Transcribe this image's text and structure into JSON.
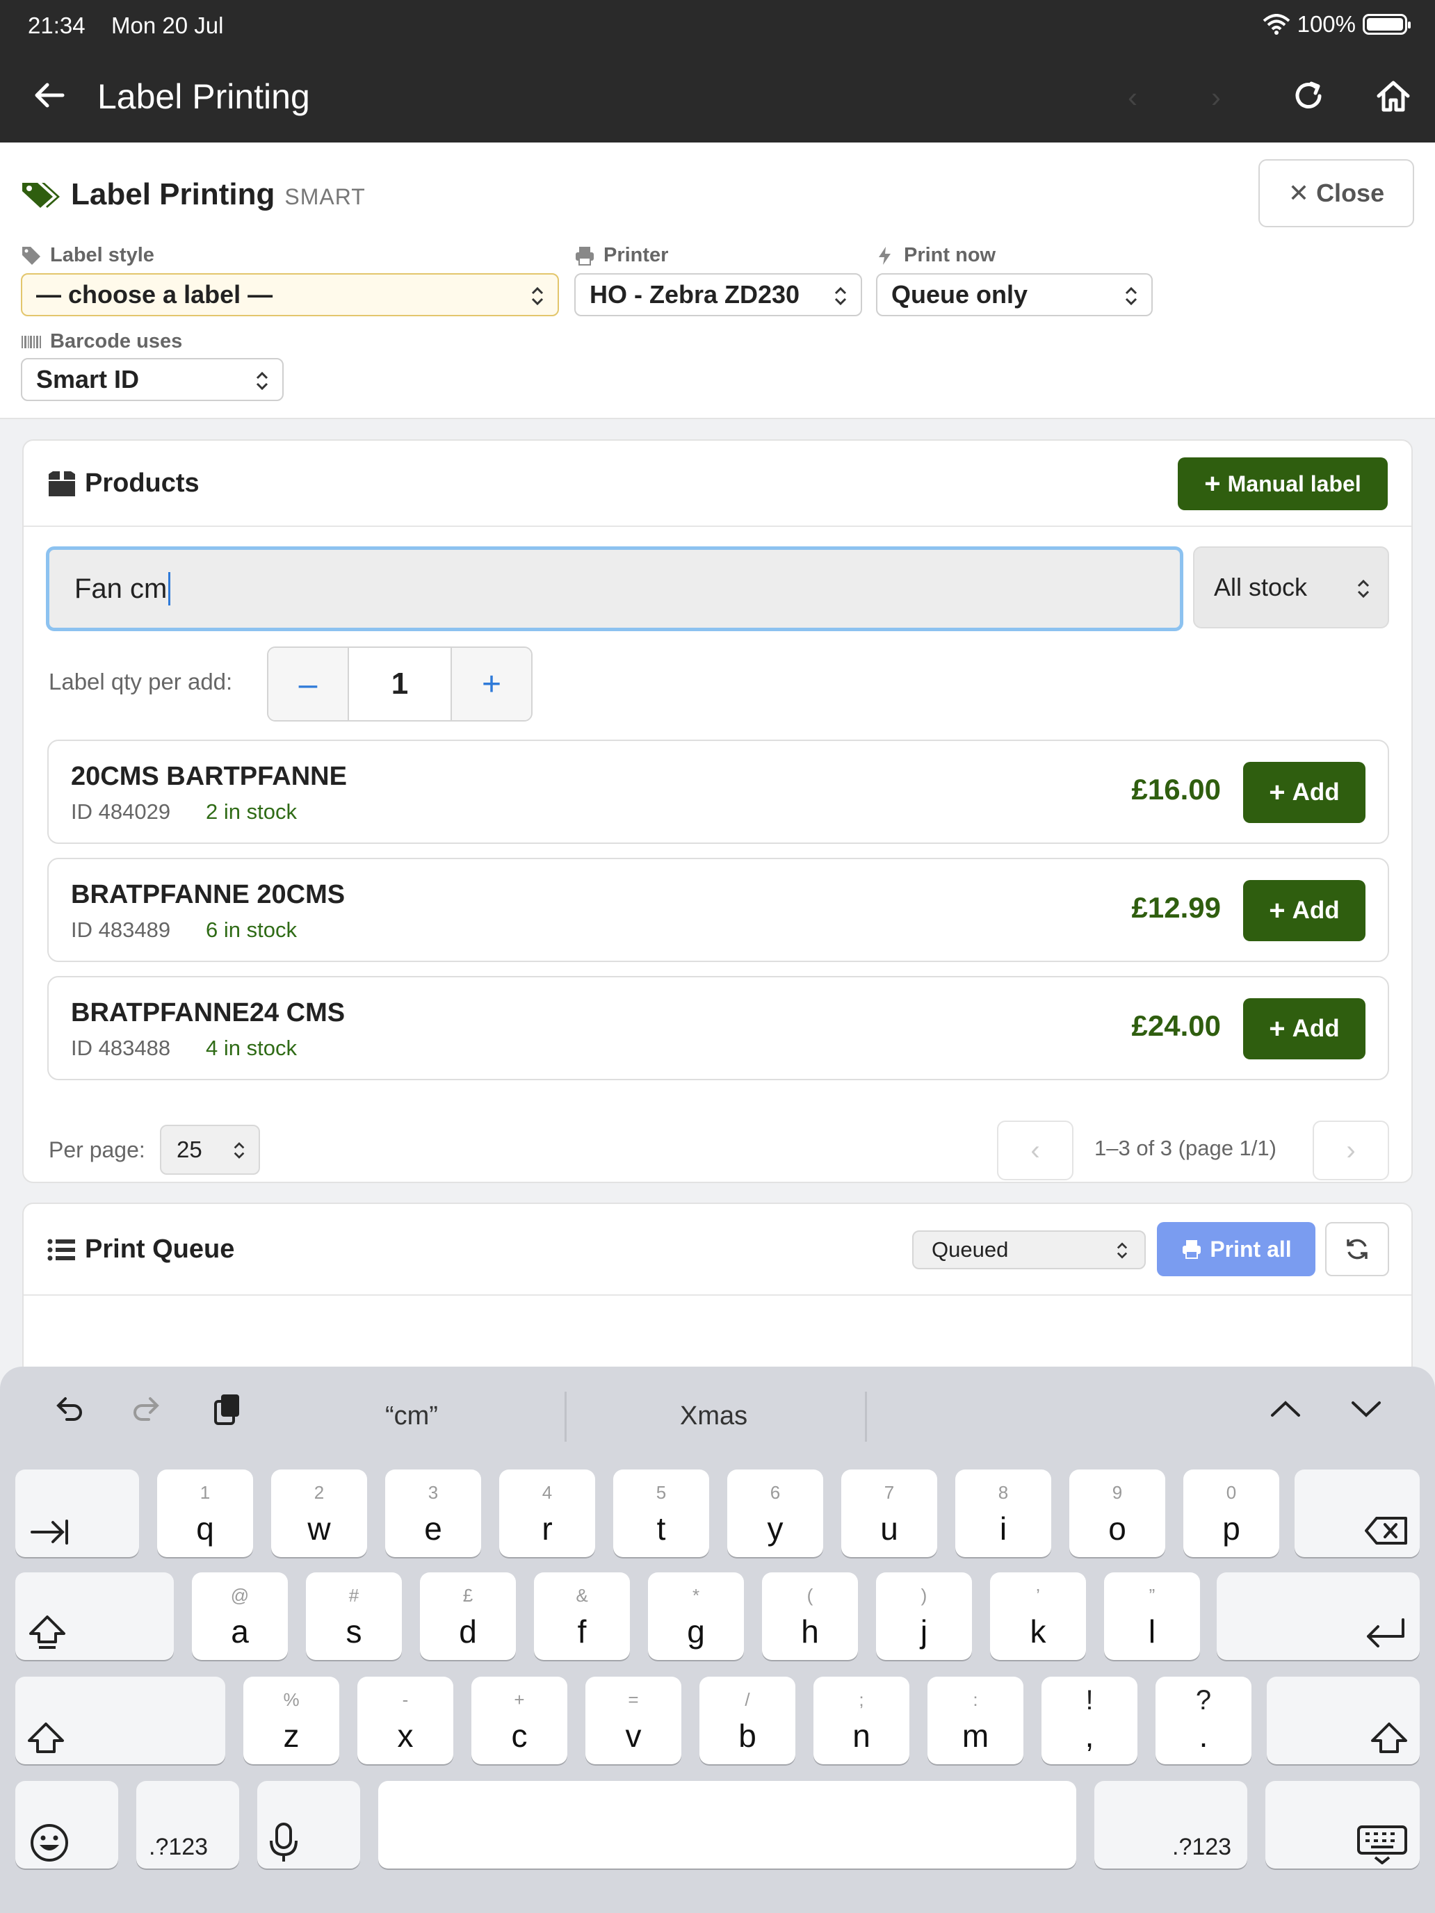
{
  "status": {
    "time": "21:34",
    "date": "Mon 20 Jul",
    "battery": "100%",
    "battery_level": 1.0
  },
  "appbar": {
    "title": "Label Printing"
  },
  "header": {
    "title": "Label Printing",
    "subtitle": "SMART",
    "close_label": "Close",
    "label_style": {
      "label": "Label style",
      "value": "— choose a label —"
    },
    "printer": {
      "label": "Printer",
      "value": "HO - Zebra ZD230"
    },
    "print_now": {
      "label": "Print now",
      "value": "Queue only"
    },
    "barcode": {
      "label": "Barcode uses",
      "value": "Smart ID"
    }
  },
  "products": {
    "title": "Products",
    "manual_label": "Manual label",
    "search_value": "Fan cm",
    "stock_filter": "All stock",
    "qty_label": "Label qty per add:",
    "qty_value": "1",
    "items": [
      {
        "name": "20CMS BARTPFANNE",
        "id": "ID 484029",
        "stock": "2 in stock",
        "price": "£16.00",
        "add": "Add"
      },
      {
        "name": "BRATPFANNE 20CMS",
        "id": "ID 483489",
        "stock": "6 in stock",
        "price": "£12.99",
        "add": "Add"
      },
      {
        "name": "BRATPFANNE24 CMS",
        "id": "ID 483488",
        "stock": "4 in stock",
        "price": "£24.00",
        "add": "Add"
      }
    ],
    "per_page_label": "Per page:",
    "per_page_value": "25",
    "pagination": "1–3 of 3 (page 1/1)"
  },
  "queue": {
    "title": "Print Queue",
    "filter": "Queued",
    "print_all": "Print all"
  },
  "keyboard": {
    "suggestions": [
      "“cm”",
      "Xmas"
    ],
    "row1": [
      {
        "k": "q",
        "s": "1"
      },
      {
        "k": "w",
        "s": "2"
      },
      {
        "k": "e",
        "s": "3"
      },
      {
        "k": "r",
        "s": "4"
      },
      {
        "k": "t",
        "s": "5"
      },
      {
        "k": "y",
        "s": "6"
      },
      {
        "k": "u",
        "s": "7"
      },
      {
        "k": "i",
        "s": "8"
      },
      {
        "k": "o",
        "s": "9"
      },
      {
        "k": "p",
        "s": "0"
      }
    ],
    "row2": [
      {
        "k": "a",
        "s": "@"
      },
      {
        "k": "s",
        "s": "#"
      },
      {
        "k": "d",
        "s": "£"
      },
      {
        "k": "f",
        "s": "&"
      },
      {
        "k": "g",
        "s": "*"
      },
      {
        "k": "h",
        "s": "("
      },
      {
        "k": "j",
        "s": ")"
      },
      {
        "k": "k",
        "s": "’"
      },
      {
        "k": "l",
        "s": "”"
      }
    ],
    "row3": [
      {
        "k": "z",
        "s": "%"
      },
      {
        "k": "x",
        "s": "-"
      },
      {
        "k": "c",
        "s": "+"
      },
      {
        "k": "v",
        "s": "="
      },
      {
        "k": "b",
        "s": "/"
      },
      {
        "k": "n",
        "s": ";"
      },
      {
        "k": "m",
        "s": ":"
      },
      {
        "k": ",",
        "s": "!"
      },
      {
        "k": ".",
        "s": "?"
      }
    ],
    "numbers_label": ".?123"
  },
  "colors": {
    "brand_green": "#2f5e0f",
    "stock_green": "#2f6b16",
    "appbar": "#2a2a2a",
    "print_all": "#7a9cf0",
    "focus": "#8cc2f0"
  }
}
